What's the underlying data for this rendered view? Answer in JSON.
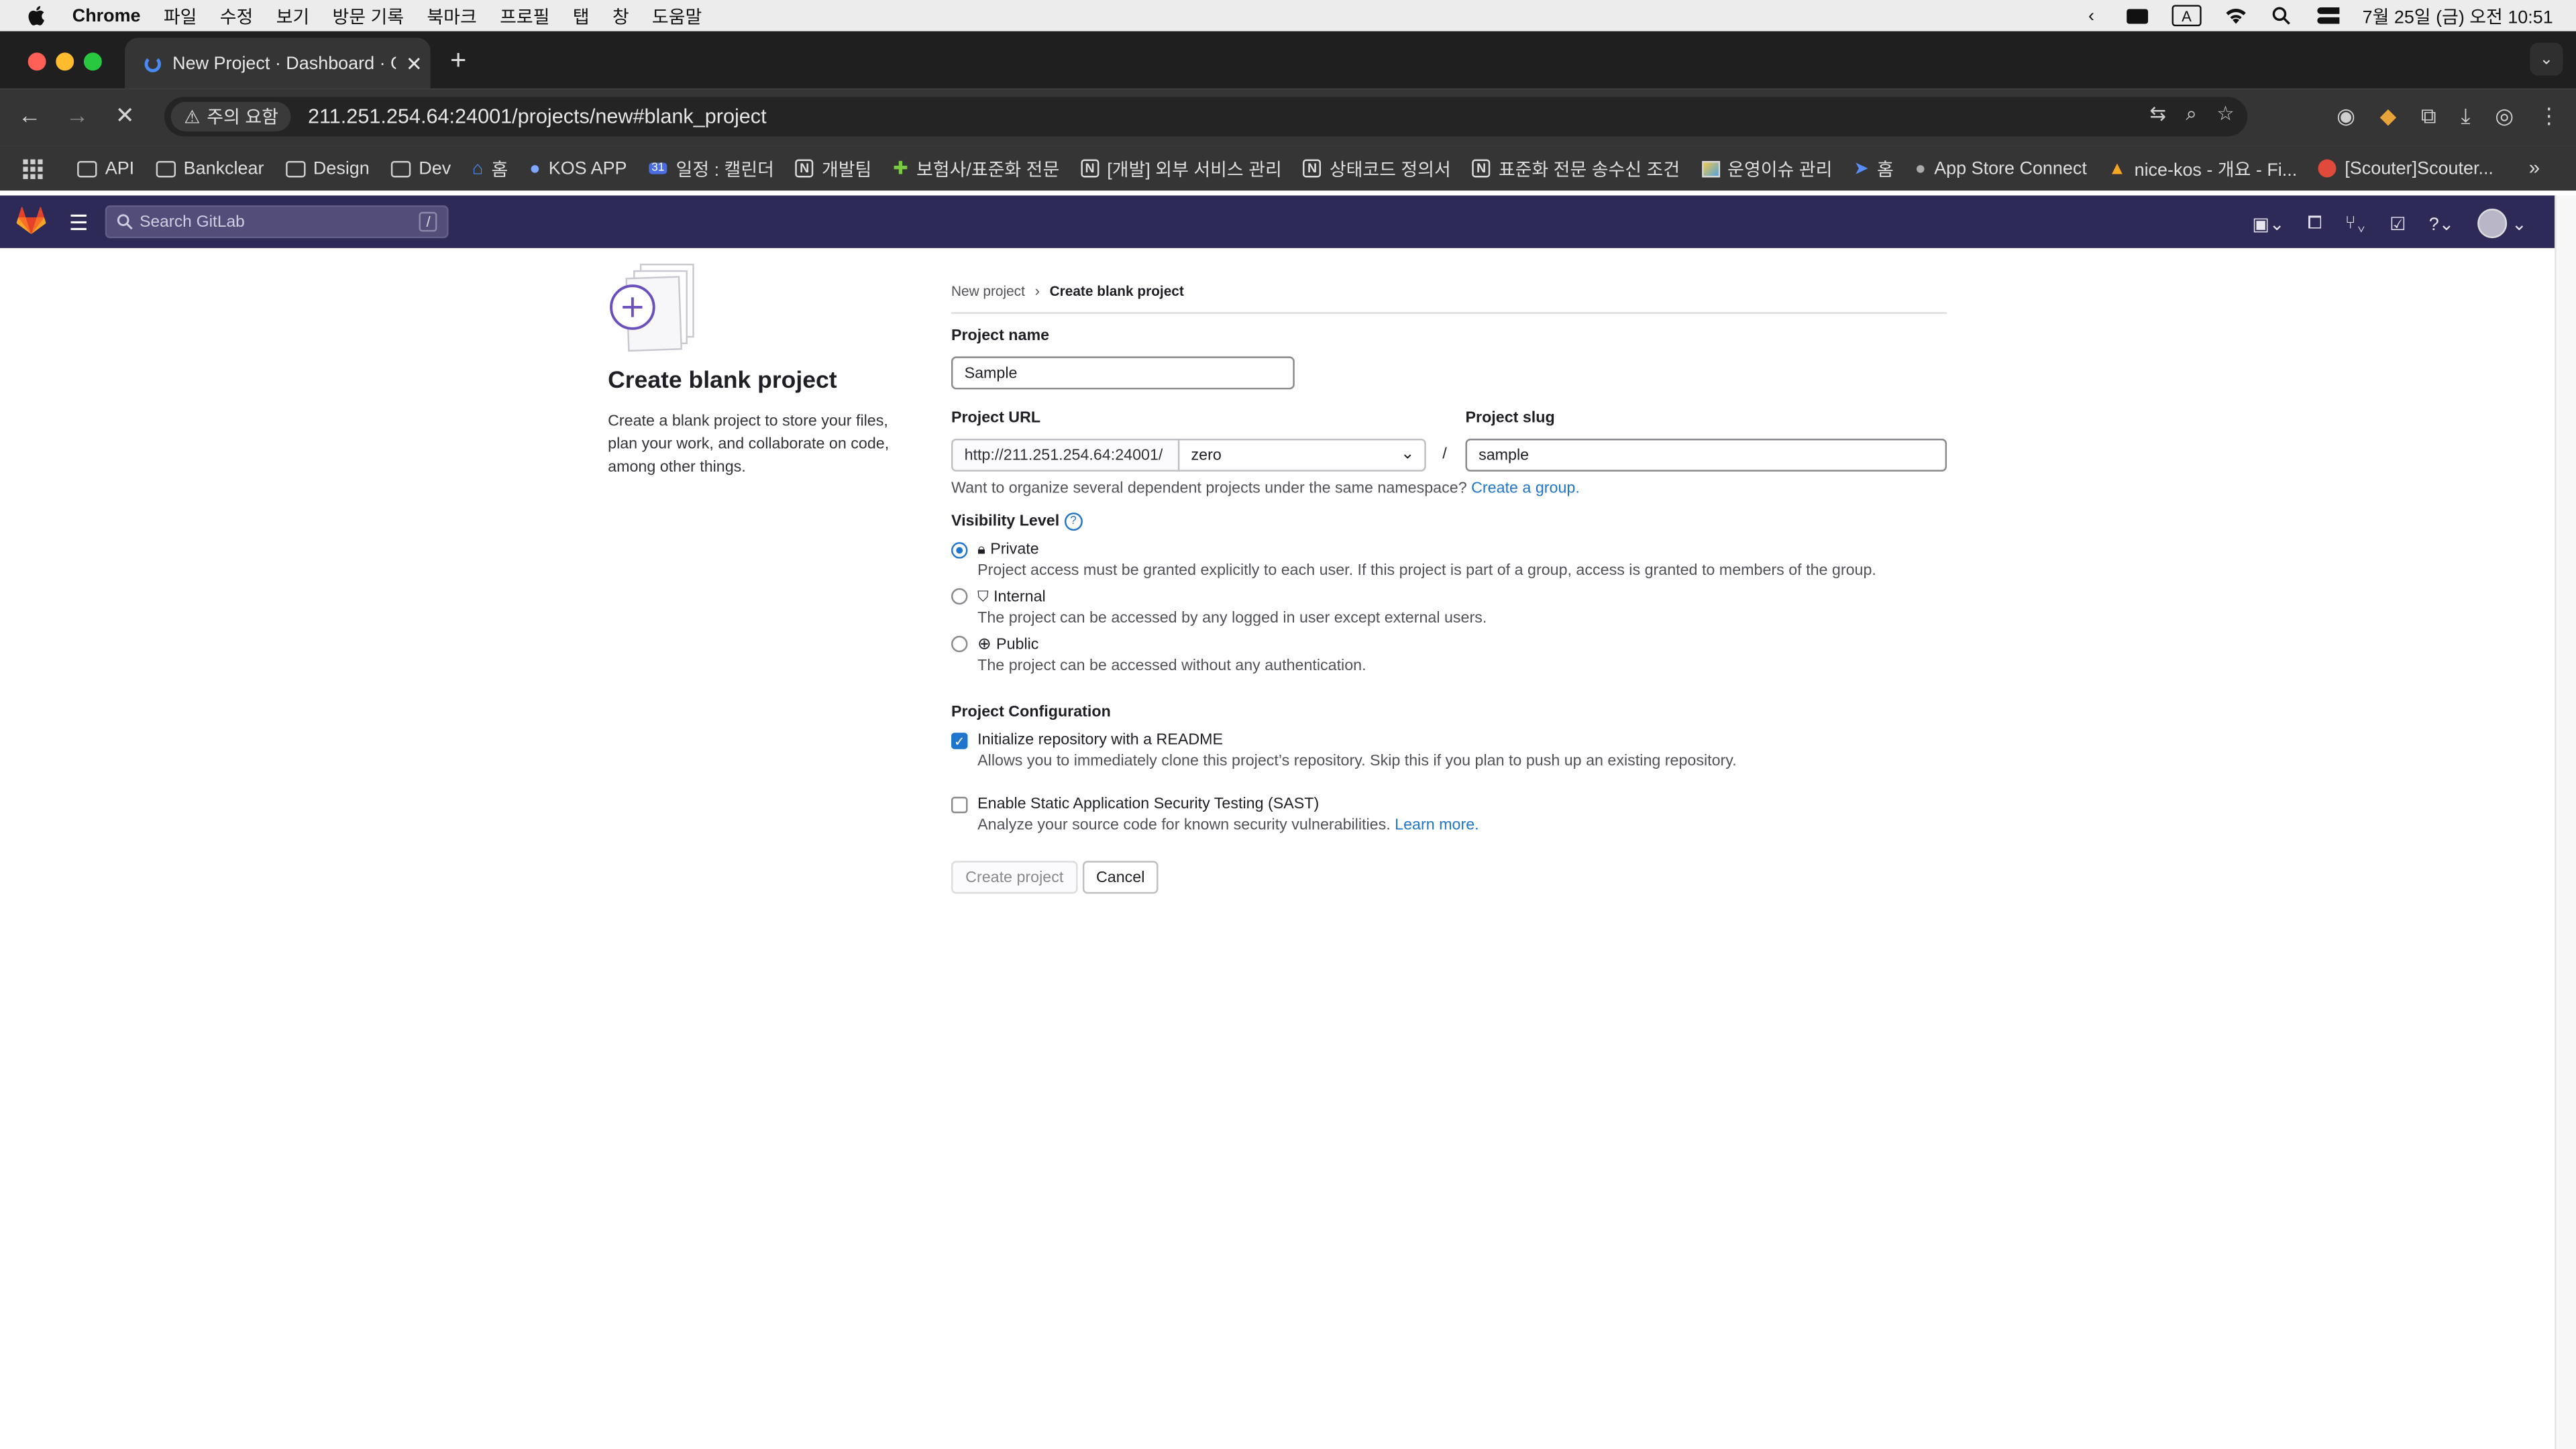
{
  "menubar": {
    "app": "Chrome",
    "items": [
      "파일",
      "수정",
      "보기",
      "방문 기록",
      "북마크",
      "프로필",
      "탭",
      "창",
      "도움말"
    ],
    "datetime": "7월 25일 (금) 오전 10:51",
    "input_indicator": "A"
  },
  "browser": {
    "tab_title": "New Project · Dashboard · GitLab",
    "security_chip": "주의 요함",
    "url": "211.251.254.64:24001/projects/new#blank_project",
    "bookmarks": [
      {
        "label": "API",
        "icon": "folder-icon"
      },
      {
        "label": "Bankclear",
        "icon": "folder-icon"
      },
      {
        "label": "Design",
        "icon": "folder-icon"
      },
      {
        "label": "Dev",
        "icon": "folder-icon"
      },
      {
        "label": "홈",
        "icon": "home-icon"
      },
      {
        "label": "KOS APP",
        "icon": "app-icon"
      },
      {
        "label": "일정 : 캘린더",
        "icon": "calendar-icon"
      },
      {
        "label": "개발팀",
        "icon": "notion-icon"
      },
      {
        "label": "보험사/표준화 전문",
        "icon": "puzzle-icon"
      },
      {
        "label": "[개발] 외부 서비스 관리",
        "icon": "notion-icon"
      },
      {
        "label": "상태코드 정의서",
        "icon": "notion-icon"
      },
      {
        "label": "표준화 전문 송수신 조건",
        "icon": "notion-icon"
      },
      {
        "label": "운영이슈 관리",
        "icon": "image-icon"
      },
      {
        "label": "홈",
        "icon": "plane-icon"
      },
      {
        "label": "App Store Connect",
        "icon": "apple-icon"
      },
      {
        "label": "nice-kos - 개요 - Fi...",
        "icon": "firebase-icon"
      },
      {
        "label": "[Scouter]Scouter...",
        "icon": "scouter-icon"
      }
    ]
  },
  "gitlab": {
    "search_placeholder": "Search GitLab",
    "search_shortcut": "/"
  },
  "page": {
    "left_title": "Create blank project",
    "left_desc": "Create a blank project to store your files, plan your work, and collaborate on code, among other things.",
    "breadcrumb_parent": "New project",
    "breadcrumb_current": "Create blank project",
    "project_name_label": "Project name",
    "project_name_value": "Sample",
    "project_url_label": "Project URL",
    "project_url_prefix": "http://211.251.254.64:24001/",
    "namespace_value": "zero",
    "url_separator": "/",
    "project_slug_label": "Project slug",
    "project_slug_value": "sample",
    "namespace_help": "Want to organize several dependent projects under the same namespace?",
    "create_group_link": "Create a group.",
    "visibility_label": "Visibility Level",
    "visibility_help_icon": "?",
    "visibility_options": [
      {
        "label": "Private",
        "desc": "Project access must be granted explicitly to each user. If this project is part of a group, access is granted to members of the group.",
        "selected": true
      },
      {
        "label": "Internal",
        "desc": "The project can be accessed by any logged in user except external users.",
        "selected": false
      },
      {
        "label": "Public",
        "desc": "The project can be accessed without any authentication.",
        "selected": false
      }
    ],
    "config_label": "Project Configuration",
    "readme_label": "Initialize repository with a README",
    "readme_desc": "Allows you to immediately clone this project’s repository. Skip this if you plan to push up an existing repository.",
    "readme_checked": true,
    "sast_label": "Enable Static Application Security Testing (SAST)",
    "sast_desc": "Analyze your source code for known security vulnerabilities.",
    "sast_link": "Learn more.",
    "sast_checked": false,
    "create_button": "Create project",
    "cancel_button": "Cancel"
  },
  "colors": {
    "gitlab_header": "#2e2a57",
    "accent": "#1f75cb",
    "chrome_dark": "#353535"
  }
}
